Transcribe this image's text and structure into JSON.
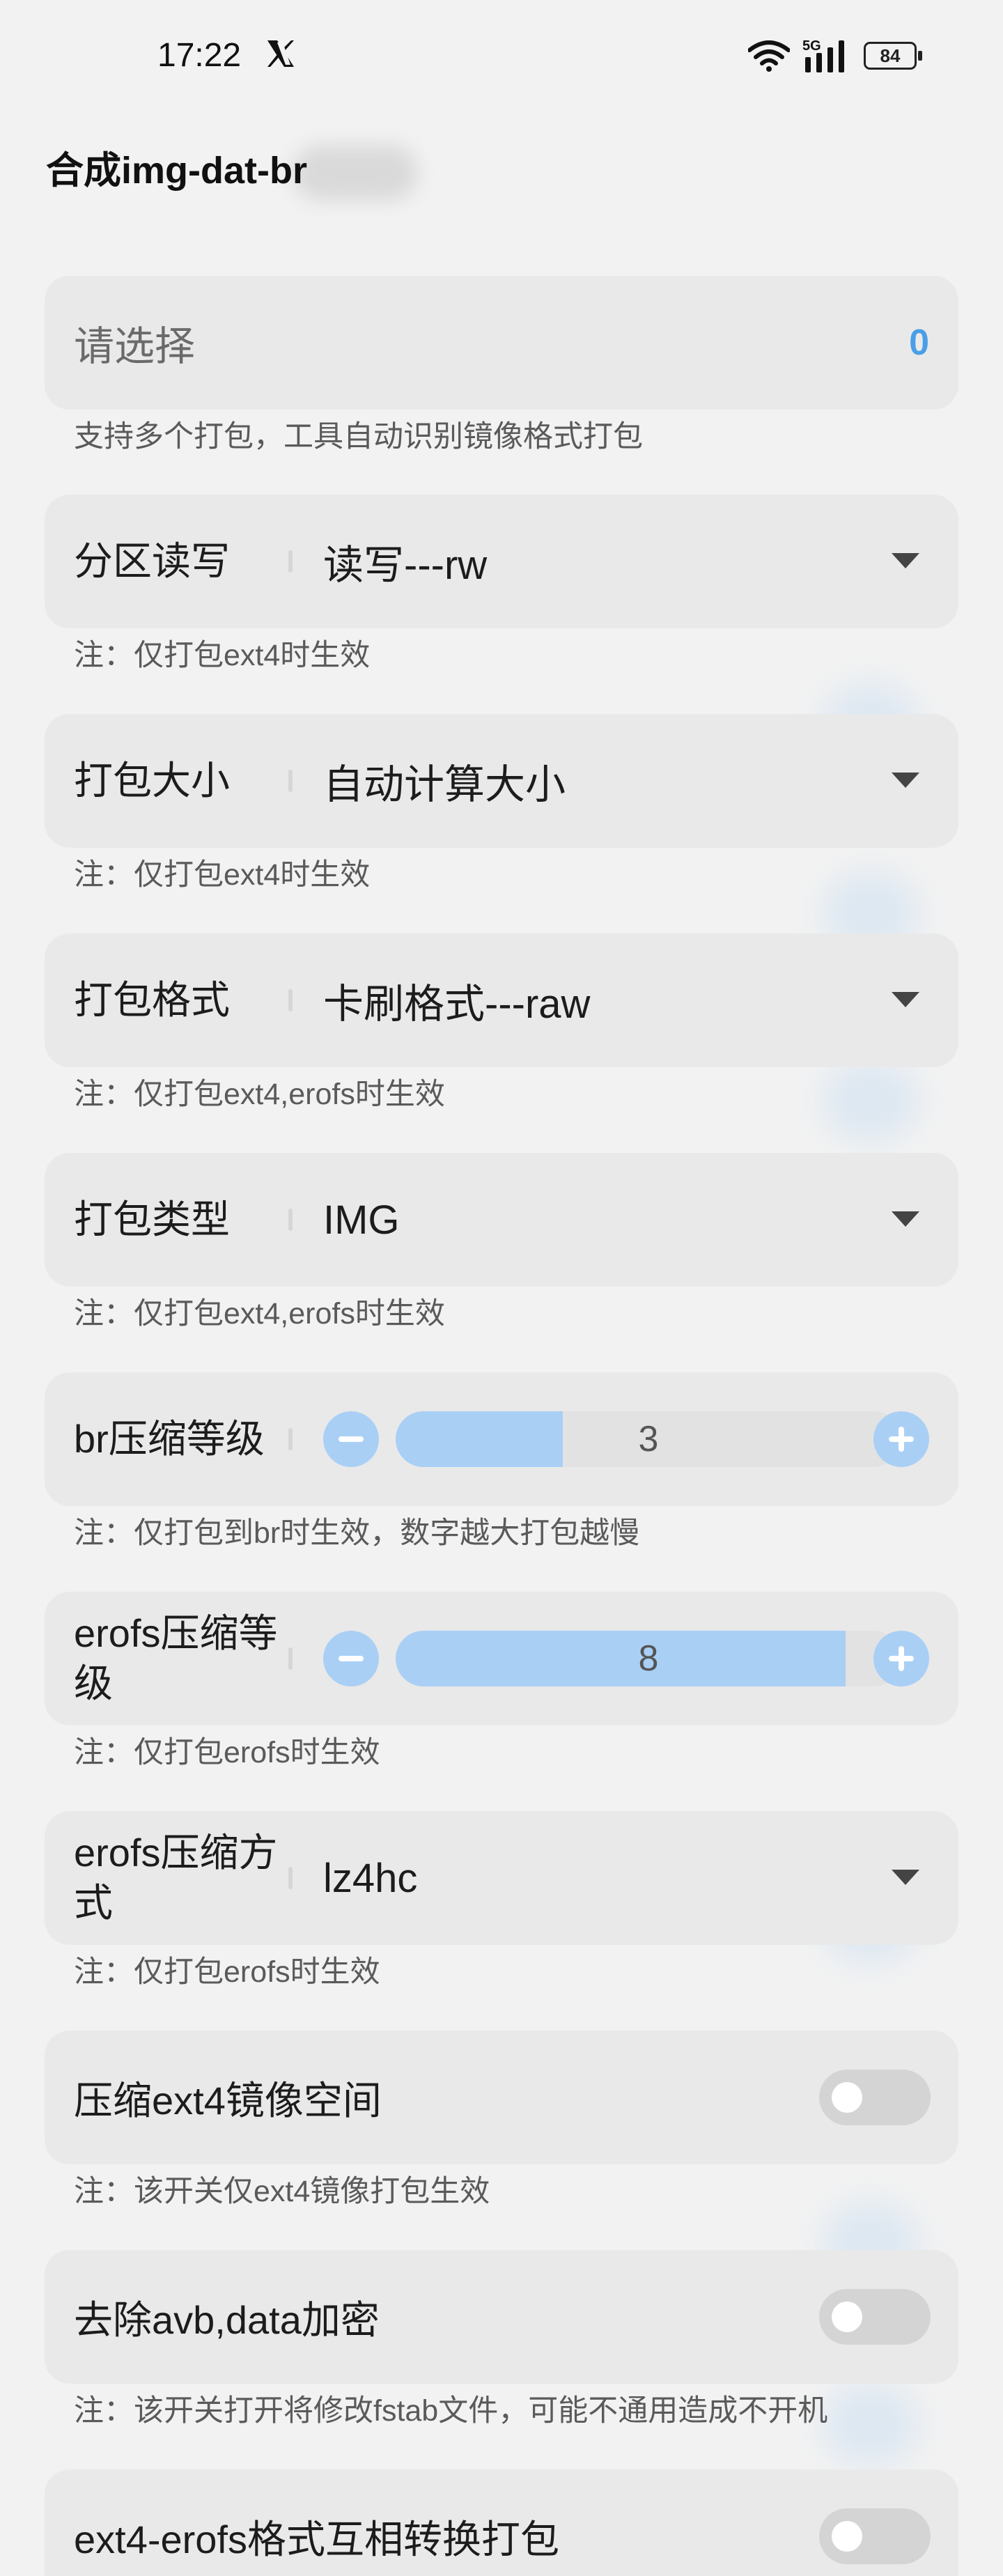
{
  "status_bar": {
    "time": "17:22",
    "battery": "84"
  },
  "header": {
    "title": "合成img-dat-br"
  },
  "choose": {
    "label": "请选择",
    "count": "0",
    "note": "支持多个打包，工具自动识别镜像格式打包"
  },
  "partition_rw": {
    "label": "分区读写",
    "value": "读写---rw",
    "note": "注：仅打包ext4时生效"
  },
  "pack_size": {
    "label": "打包大小",
    "value": "自动计算大小",
    "note": "注：仅打包ext4时生效"
  },
  "pack_format": {
    "label": "打包格式",
    "value": "卡刷格式---raw",
    "note": "注：仅打包ext4,erofs时生效"
  },
  "pack_type": {
    "label": "打包类型",
    "value": "IMG",
    "note": "注：仅打包ext4,erofs时生效"
  },
  "br_level": {
    "label": "br压缩等级",
    "value": "3",
    "fill_fraction": 0.33,
    "note": "注：仅打包到br时生效，数字越大打包越慢"
  },
  "erofs_level": {
    "label": "erofs压缩等级",
    "value": "8",
    "fill_fraction": 0.89,
    "note": "注：仅打包erofs时生效"
  },
  "erofs_method": {
    "label": "erofs压缩方式",
    "value": "lz4hc",
    "note": "注：仅打包erofs时生效"
  },
  "compress_ext4": {
    "label": "压缩ext4镜像空间",
    "enabled": false,
    "note": "注：该开关仅ext4镜像打包生效"
  },
  "remove_avb": {
    "label": "去除avb,data加密",
    "enabled": false,
    "note": "注：该开关打开将修改fstab文件，可能不通用造成不开机"
  },
  "ext4_erofs_convert": {
    "label": "ext4-erofs格式互相转换打包",
    "enabled": false
  },
  "colors": {
    "accent": "#4a9ee8",
    "accent_light": "#a9cff5",
    "card_bg": "#e9e9e9",
    "page_bg": "#f2f2f2"
  }
}
